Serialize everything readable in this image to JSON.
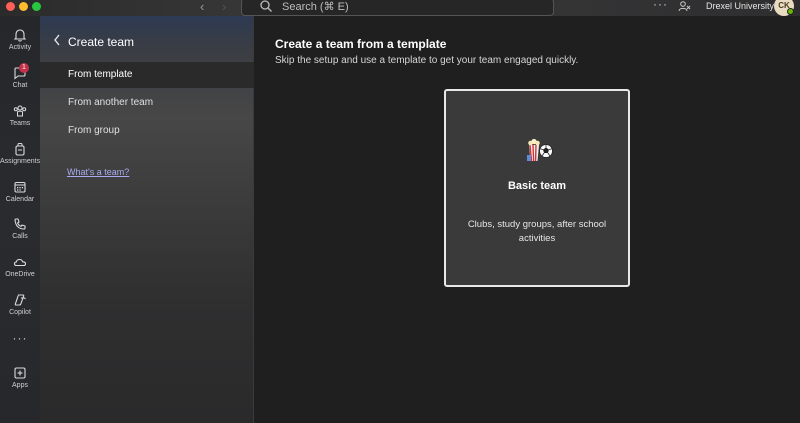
{
  "titlebar": {
    "search_placeholder": "Search (⌘ E)",
    "more": "···",
    "org_name": "Drexel University",
    "avatar_initials": "CK"
  },
  "rail": {
    "items": [
      {
        "label": "Activity",
        "icon": "bell-icon"
      },
      {
        "label": "Chat",
        "icon": "chat-icon",
        "badge": "1"
      },
      {
        "label": "Teams",
        "icon": "teams-icon"
      },
      {
        "label": "Assignments",
        "icon": "backpack-icon"
      },
      {
        "label": "Calendar",
        "icon": "calendar-icon"
      },
      {
        "label": "Calls",
        "icon": "phone-icon"
      },
      {
        "label": "OneDrive",
        "icon": "cloud-icon"
      },
      {
        "label": "Copilot",
        "icon": "copilot-icon"
      },
      {
        "label": "Apps",
        "icon": "plus-square-icon"
      }
    ],
    "more": "···"
  },
  "panel": {
    "title": "Create team",
    "items": [
      {
        "label": "From template",
        "selected": true
      },
      {
        "label": "From another team",
        "selected": false
      },
      {
        "label": "From group",
        "selected": false
      }
    ],
    "link": "What's a team?"
  },
  "main": {
    "title": "Create a team from a template",
    "subtitle": "Skip the setup and use a template to get your team engaged quickly.",
    "card": {
      "title": "Basic team",
      "description": "Clubs, study groups, after school activities",
      "icon": "popcorn-soccer-icon"
    }
  },
  "colors": {
    "accent_link": "#a8abf0",
    "badge": "#c4314b",
    "presence": "#6bb700"
  }
}
